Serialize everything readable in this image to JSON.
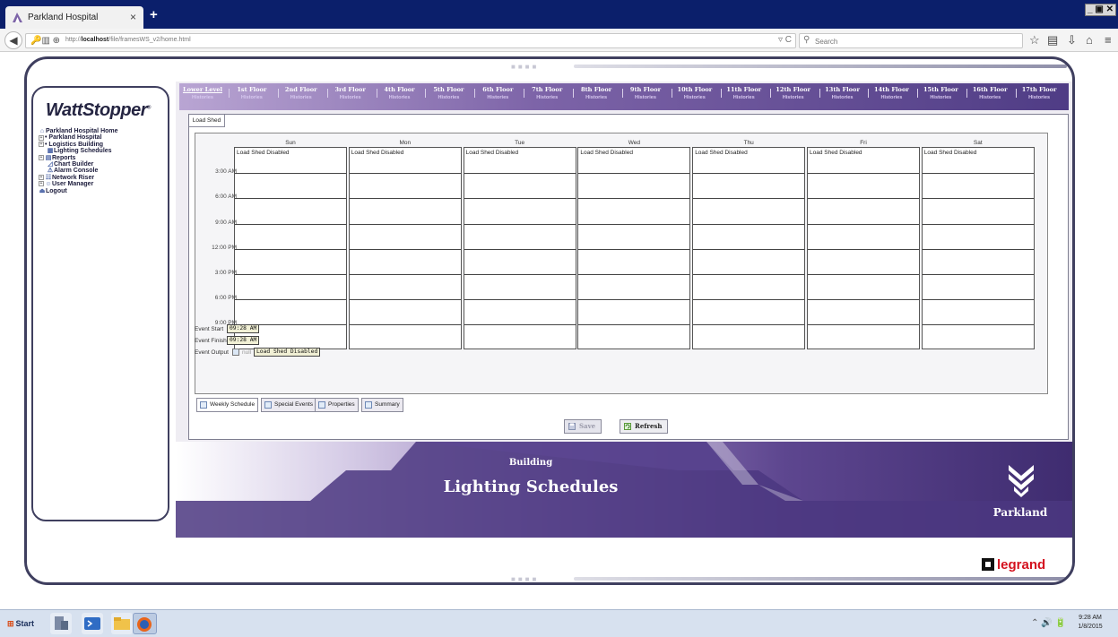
{
  "browser": {
    "tab_title": "Parkland Hospital",
    "tab_close": "×",
    "new_tab": "+",
    "window_controls": "_ ▣ ✕",
    "url_prefix": "http://",
    "url_host": "localhost",
    "url_path": "/file/framesWS_v2/home.html",
    "search_placeholder": "Search",
    "icons": [
      "back-icon",
      "lock-icon",
      "reload-icon",
      "search-icon",
      "bookmark-star-icon",
      "library-icon",
      "download-icon",
      "home-icon",
      "menu-icon"
    ]
  },
  "sidebar": {
    "logo": "WattStopper",
    "logo_mark": "®",
    "tree": [
      {
        "label": "Parkland Hospital Home",
        "indent": 0,
        "icon": "home-icon",
        "expander": ""
      },
      {
        "label": "• Parkland Hospital",
        "indent": 0,
        "icon": "",
        "expander": "+"
      },
      {
        "label": "• Logistics Building",
        "indent": 0,
        "icon": "",
        "expander": "+"
      },
      {
        "label": "Lighting Schedules",
        "indent": 1,
        "icon": "calendar-icon",
        "expander": ""
      },
      {
        "label": "Reports",
        "indent": 0,
        "icon": "report-icon",
        "expander": "+"
      },
      {
        "label": "Chart Builder",
        "indent": 1,
        "icon": "chart-icon",
        "expander": ""
      },
      {
        "label": "Alarm Console",
        "indent": 1,
        "icon": "alarm-icon",
        "expander": ""
      },
      {
        "label": "Network Riser",
        "indent": 0,
        "icon": "network-icon",
        "expander": "+"
      },
      {
        "label": "User Manager",
        "indent": 0,
        "icon": "users-icon",
        "expander": "+"
      },
      {
        "label": "Logout",
        "indent": 0,
        "icon": "logout-icon",
        "expander": ""
      }
    ]
  },
  "floors": {
    "history_label": "Histories",
    "items": [
      "Lower Level",
      "1st Floor",
      "2nd Floor",
      "3rd Floor",
      "4th Floor",
      "5th Floor",
      "6th Floor",
      "7th Floor",
      "8th Floor",
      "9th Floor",
      "10th Floor",
      "11th Floor",
      "12th Floor",
      "13th Floor",
      "14th Floor",
      "15th Floor",
      "16th Floor",
      "17th Floor"
    ]
  },
  "schedule": {
    "top_tab": "Load Shed",
    "days": [
      "Sun",
      "Mon",
      "Tue",
      "Wed",
      "Thu",
      "Fri",
      "Sat"
    ],
    "event_text": "Load Shed Disabled",
    "times": [
      "3:00 AM",
      "6:00 AM",
      "9:00 AM",
      "12:00 PM",
      "3:00 PM",
      "6:00 PM",
      "9:00 PM"
    ],
    "event_start_label": "Event Start",
    "event_start_value": "09:28 AM",
    "event_finish_label": "Event Finish",
    "event_finish_value": "09:28 AM",
    "event_output_label": "Event Output",
    "event_output_null": "null",
    "event_output_value": "Load Shed Disabled",
    "bottom_tabs": [
      "Weekly Schedule",
      "Special Events",
      "Properties",
      "Summary"
    ],
    "save_label": "Save",
    "refresh_label": "Refresh"
  },
  "banner": {
    "subtitle": "Building",
    "title": "Lighting Schedules",
    "brand": "Parkland"
  },
  "footer_brand": "legrand",
  "taskbar": {
    "start_label": "Start",
    "tray_icons": "⌃ 🔊 🔋",
    "time": "9:28 AM",
    "date": "1/8/2015"
  },
  "colors": {
    "titlebar": "#0b1f6b",
    "frame_border": "#3f3f5f",
    "banner_dark": "#3f2c70",
    "accent_red": "#d4111e"
  }
}
